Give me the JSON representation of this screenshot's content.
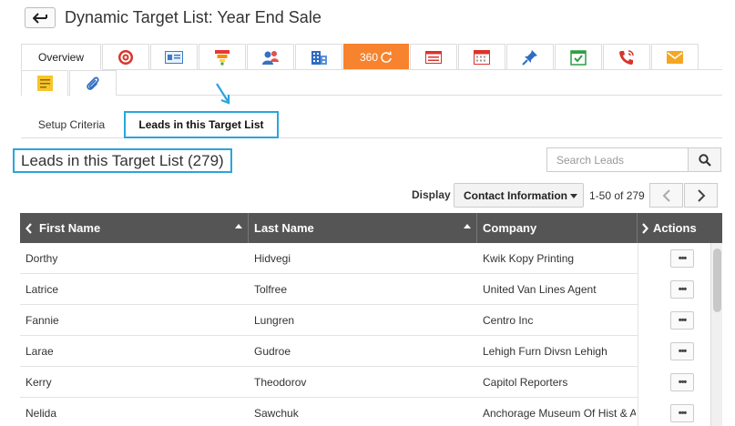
{
  "header": {
    "back_icon": "back-arrow-icon",
    "title": "Dynamic Target List: Year End Sale"
  },
  "tabs": {
    "overview_label": "Overview",
    "icons": [
      "target-icon",
      "contact-card-icon",
      "funnel-icon",
      "users-icon",
      "building-icon",
      "360-view-icon",
      "list-icon",
      "calendar-icon",
      "pin-icon",
      "task-check-icon",
      "phone-call-icon",
      "mail-icon",
      "note-icon",
      "attachment-icon"
    ],
    "label_360": "360",
    "active_color": "#f7832e"
  },
  "subtabs": {
    "setup": "Setup Criteria",
    "leads": "Leads in this Target List"
  },
  "section": {
    "title": "Leads in this Target List (279)"
  },
  "search": {
    "placeholder": "Search Leads",
    "icon": "search-icon"
  },
  "toolbar": {
    "display_label": "Display",
    "display_value": "Contact Information",
    "pager_text": "1-50 of 279"
  },
  "grid": {
    "columns": [
      "First Name",
      "Last Name",
      "Company",
      "Actions"
    ],
    "action_label": "•••",
    "rows": [
      {
        "first": "Dorthy",
        "last": "Hidvegi",
        "company": "Kwik Kopy Printing"
      },
      {
        "first": "Latrice",
        "last": "Tolfree",
        "company": "United Van Lines Agent"
      },
      {
        "first": "Fannie",
        "last": "Lungren",
        "company": "Centro Inc"
      },
      {
        "first": "Larae",
        "last": "Gudroe",
        "company": "Lehigh Furn Divsn Lehigh"
      },
      {
        "first": "Kerry",
        "last": "Theodorov",
        "company": "Capitol Reporters"
      },
      {
        "first": "Nelida",
        "last": "Sawchuk",
        "company": "Anchorage Museum Of Hist & A"
      }
    ]
  },
  "colors": {
    "highlight": "#2aa5dc",
    "header_bg": "#555555"
  }
}
